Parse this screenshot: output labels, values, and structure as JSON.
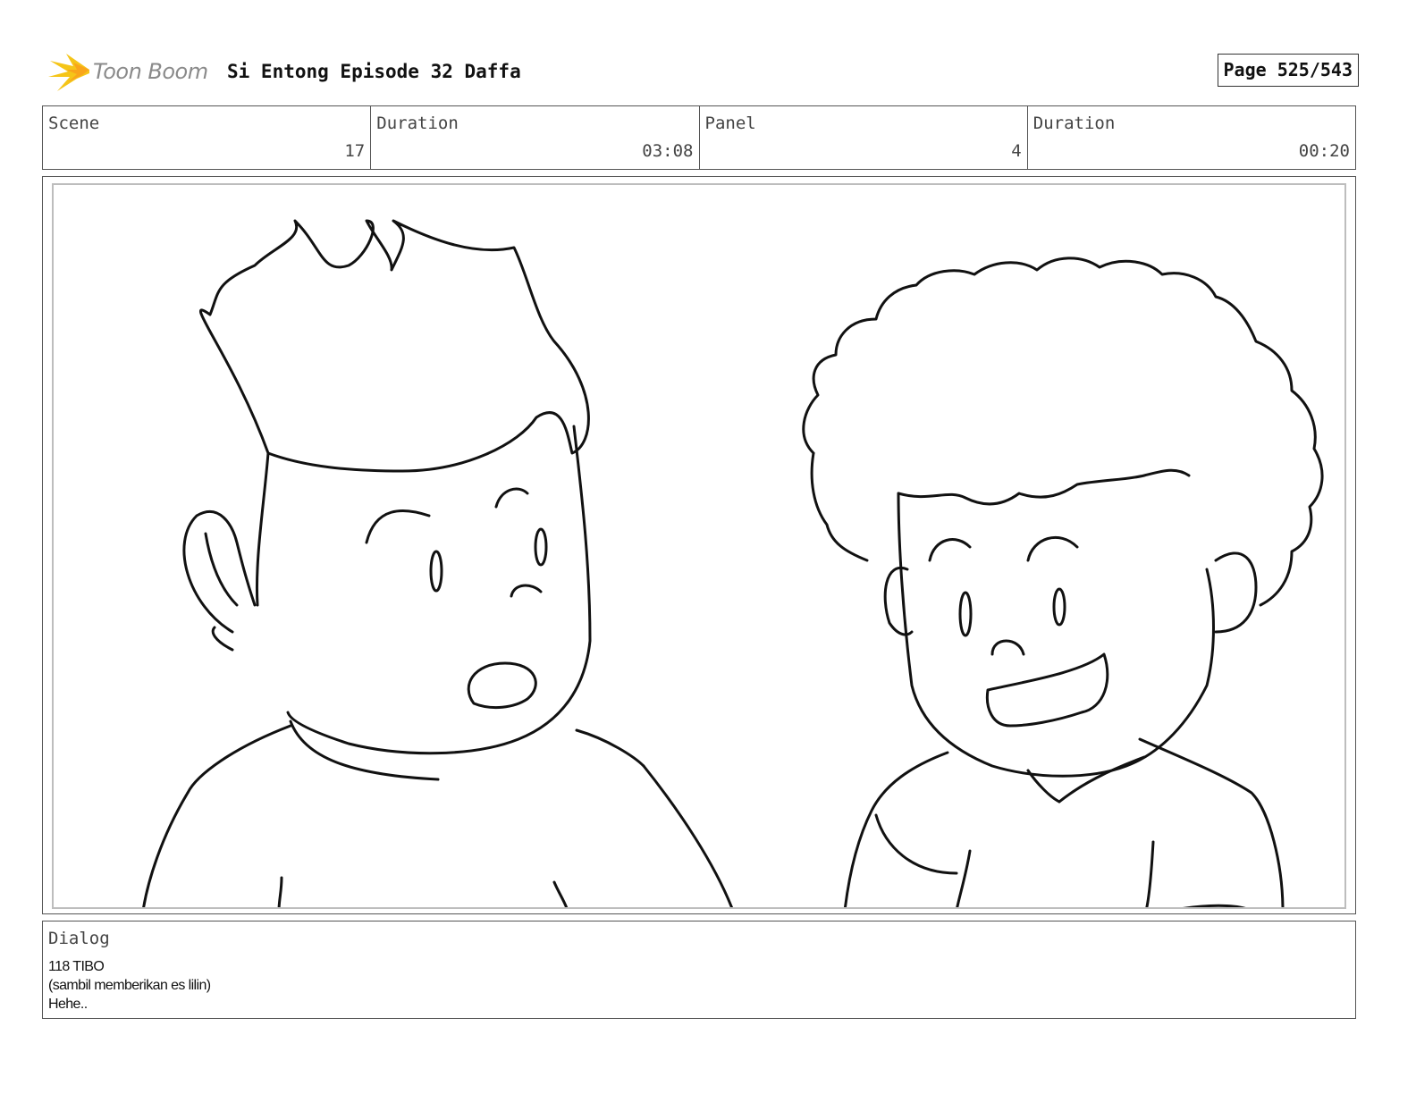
{
  "header": {
    "logo_text": "Toon Boom",
    "title": "Si Entong Episode 32 Daffa",
    "page": "Page 525/543"
  },
  "info": {
    "scene_label": "Scene",
    "scene_value": "17",
    "scene_duration_label": "Duration",
    "scene_duration_value": "03:08",
    "panel_label": "Panel",
    "panel_value": "4",
    "panel_duration_label": "Duration",
    "panel_duration_value": "00:20"
  },
  "dialog": {
    "label": "Dialog",
    "lines": [
      "118 TIBO",
      "(sambil memberikan es lilin)",
      "Hehe.."
    ]
  },
  "colors": {
    "logo_accent": "#f5c518",
    "ink": "#111111",
    "frame": "#555555"
  }
}
